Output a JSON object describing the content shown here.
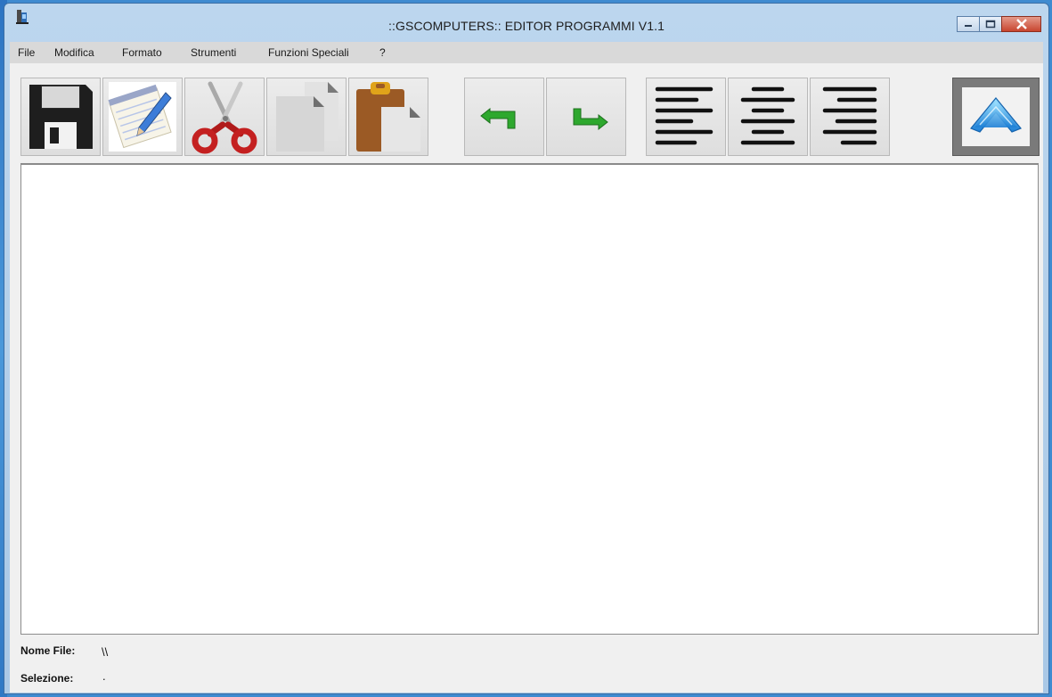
{
  "window": {
    "title": "::GSCOMPUTERS::  EDITOR PROGRAMMI V1.1"
  },
  "menu": [
    "File",
    "Modifica",
    "Formato",
    "Strumenti",
    "Funzioni Speciali",
    "?"
  ],
  "toolbar": {
    "save_icon": "floppy-disk-icon",
    "new_icon": "notepad-pencil-icon",
    "cut_icon": "scissors-icon",
    "copy_icon": "copy-pages-icon",
    "paste_icon": "clipboard-icon",
    "undo_icon": "undo-arrow-icon",
    "redo_icon": "redo-arrow-icon",
    "align_left_icon": "align-left-icon",
    "align_center_icon": "align-center-icon",
    "align_right_icon": "align-right-icon",
    "eject_icon": "up-arrow-icon"
  },
  "status": {
    "file_label": "Nome File:",
    "file_value": "\\\\",
    "selection_label": "Selezione:",
    "selection_value": "."
  },
  "colors": {
    "window_frame": "#a9c8e6",
    "close_button": "#c8452f",
    "client_bg": "#f0f0f0"
  }
}
